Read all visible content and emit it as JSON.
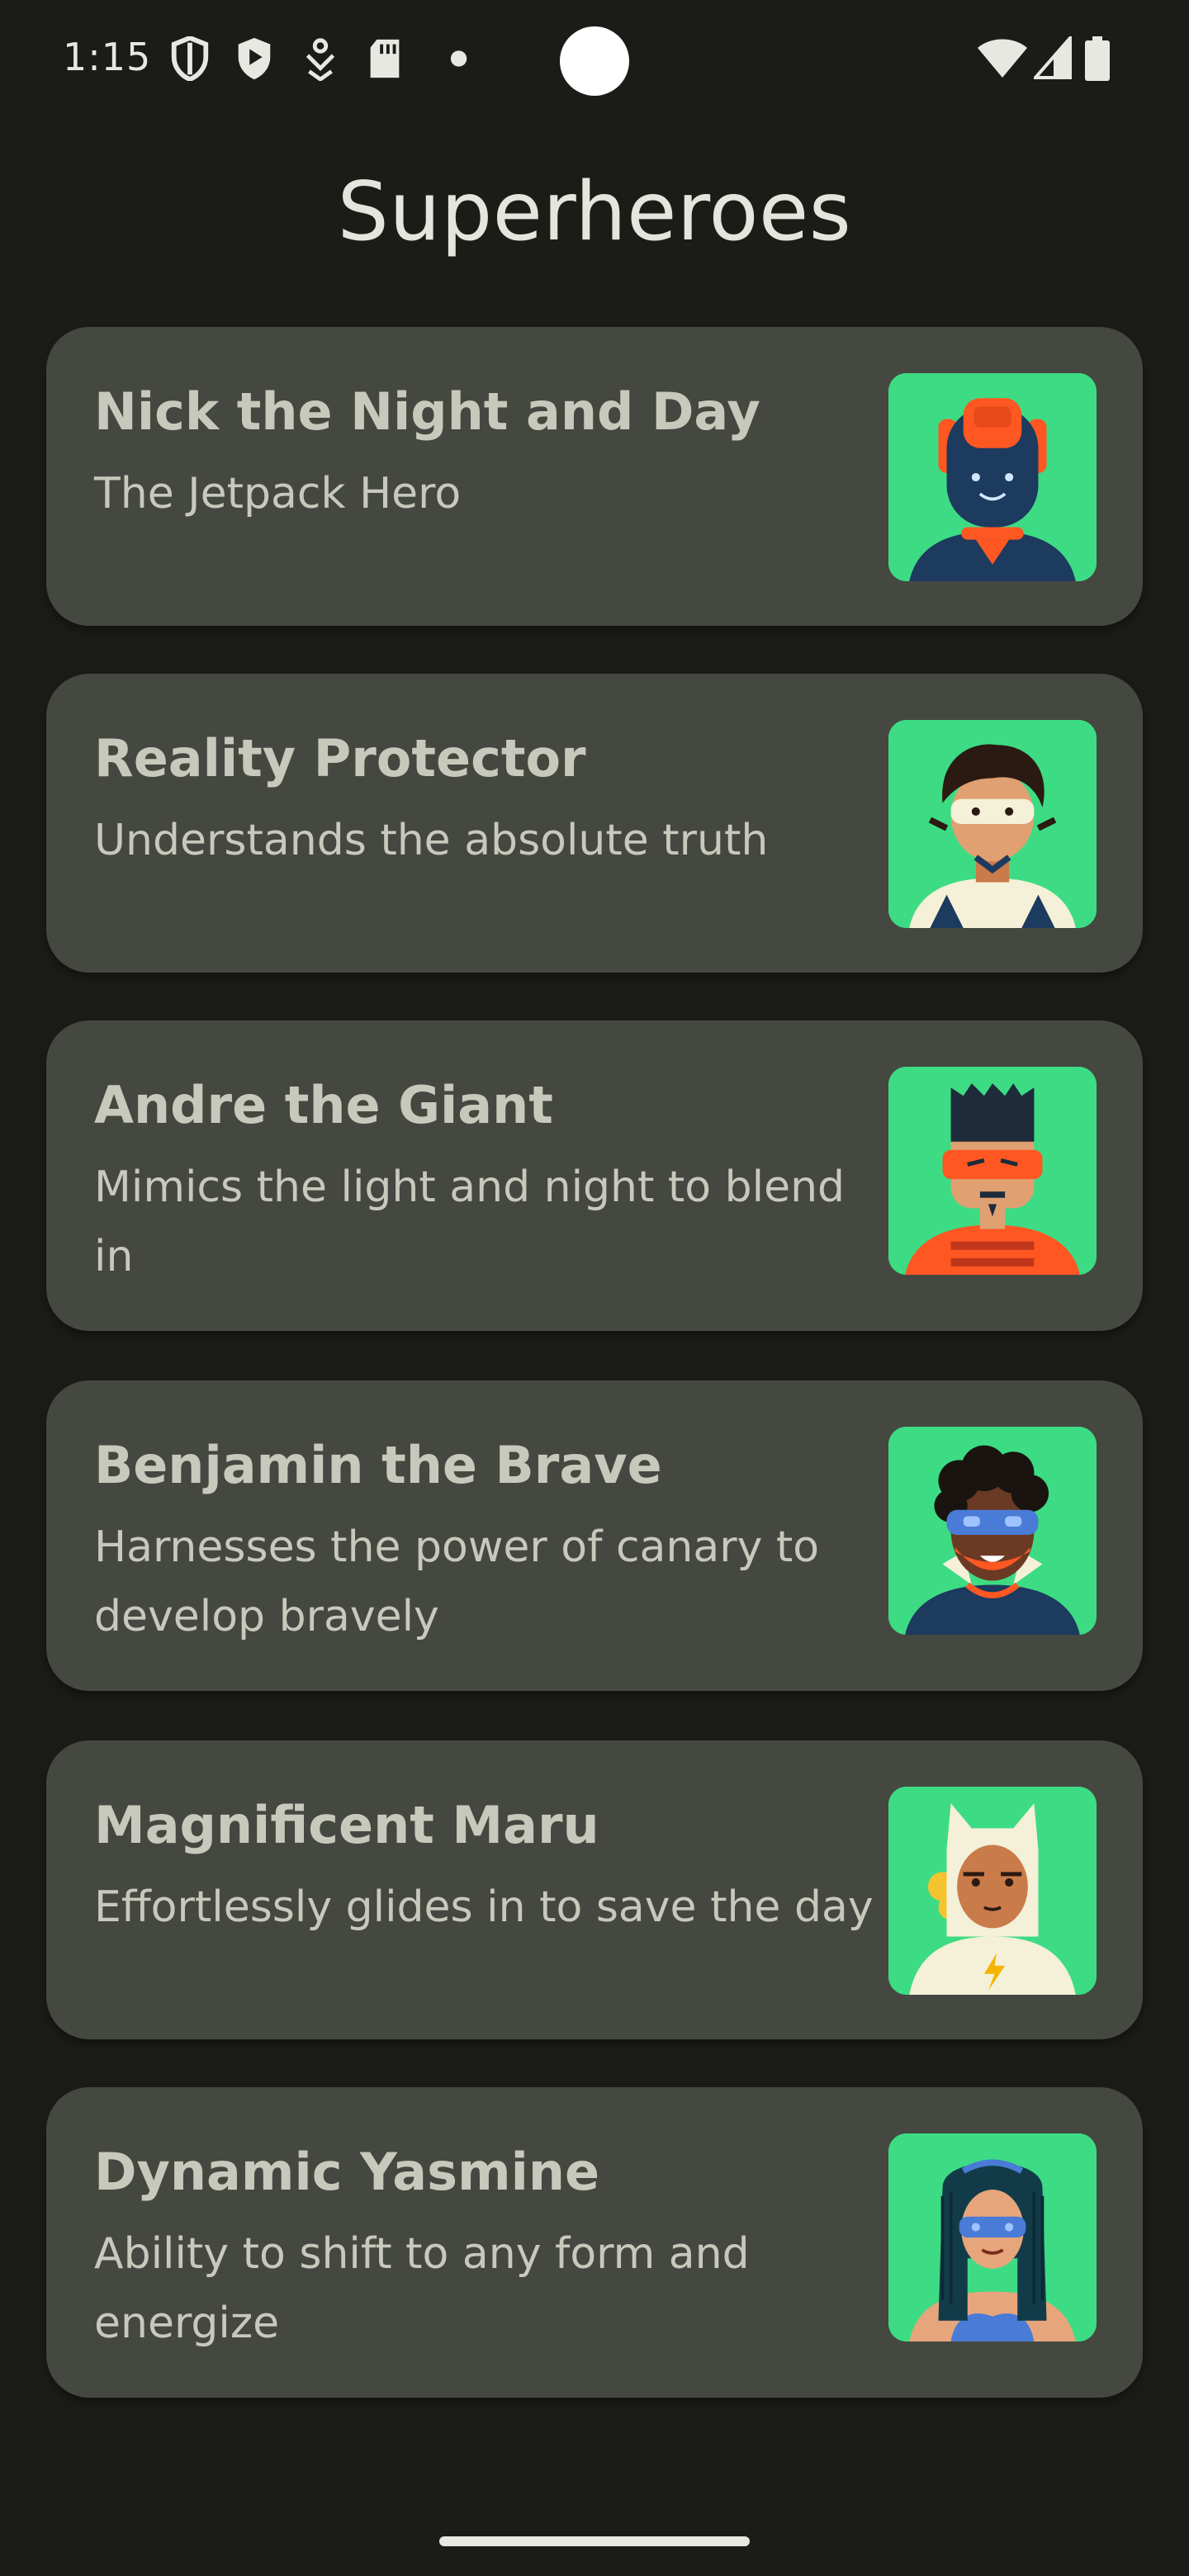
{
  "status_bar": {
    "time": "1:15",
    "left_icons": [
      "shield-icon",
      "play-shield-icon",
      "download-icon",
      "sd-card-icon",
      "dot-icon"
    ],
    "right_icons": [
      "wifi-icon",
      "cellular-signal-icon",
      "battery-icon"
    ]
  },
  "app": {
    "title": "Superheroes"
  },
  "heroes": [
    {
      "name": "Nick the Night and Day",
      "description": "The Jetpack Hero",
      "avatar": "hero-avatar-nick"
    },
    {
      "name": "Reality Protector",
      "description": "Understands the absolute truth",
      "avatar": "hero-avatar-reality"
    },
    {
      "name": "Andre the Giant",
      "description": "Mimics the light and night to blend in",
      "avatar": "hero-avatar-andre"
    },
    {
      "name": "Benjamin the Brave",
      "description": "Harnesses the power of canary to develop bravely",
      "avatar": "hero-avatar-benjamin"
    },
    {
      "name": "Magnificent Maru",
      "description": "Effortlessly glides in to save the day",
      "avatar": "hero-avatar-maru"
    },
    {
      "name": "Dynamic Yasmine",
      "description": "Ability to shift to any form and energize",
      "avatar": "hero-avatar-yasmine"
    }
  ],
  "colors": {
    "background": "#1b1c18",
    "card": "#454840",
    "text": "#c7c9bc",
    "avatar_bg": "#3ddc84"
  }
}
